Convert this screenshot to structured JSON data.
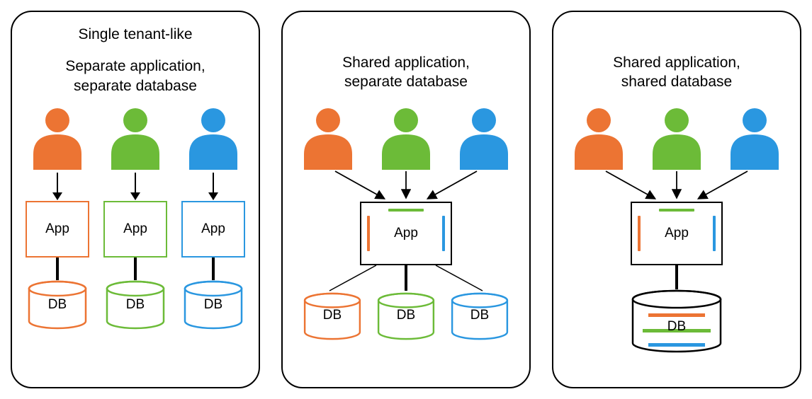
{
  "colors": {
    "orange": "#ec7433",
    "green": "#6cbb38",
    "blue": "#2a97e0"
  },
  "panels": [
    {
      "id": "separate-separate",
      "heading1": "Single tenant-like",
      "heading2": "Separate application,\nseparate database",
      "app_label": "App",
      "db_label": "DB",
      "apps": 3,
      "databases": 3,
      "users": 3,
      "app_shared": false,
      "db_shared": false
    },
    {
      "id": "shared-separate",
      "heading1": "",
      "heading2": "Shared application,\nseparate database",
      "app_label": "App",
      "db_label": "DB",
      "apps": 1,
      "databases": 3,
      "users": 3,
      "app_shared": true,
      "db_shared": false
    },
    {
      "id": "shared-shared",
      "heading1": "",
      "heading2": "Shared application,\nshared database",
      "app_label": "App",
      "db_label": "DB",
      "apps": 1,
      "databases": 1,
      "users": 3,
      "app_shared": true,
      "db_shared": true
    }
  ]
}
